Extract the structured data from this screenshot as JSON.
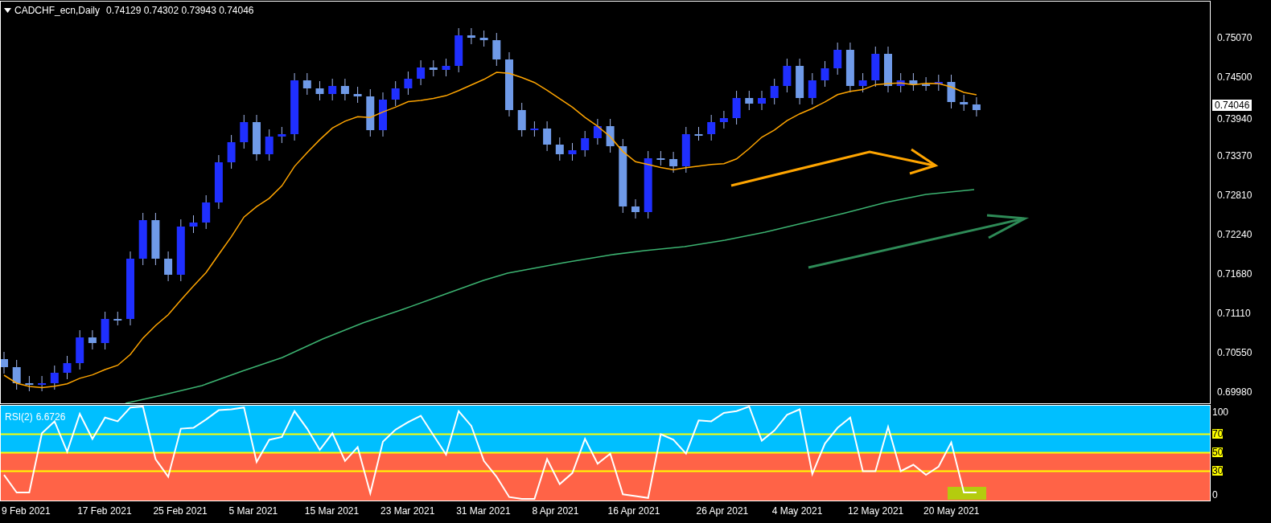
{
  "chart_header": {
    "symbol": "CADCHF_ecn,Daily",
    "ohlc": "0.74129 0.74302 0.73943 0.74046"
  },
  "price_axis": {
    "labels": [
      "0.75070",
      "0.74500",
      "0.73940",
      "0.73370",
      "0.72810",
      "0.72240",
      "0.71680",
      "0.71110",
      "0.70550",
      "0.69980"
    ],
    "current_price": "0.74046"
  },
  "rsi_panel": {
    "current_reading": "6.6726",
    "chart_data": {
      "type": "line",
      "grid": true,
      "ylim": [
        0,
        100
      ],
      "yticks": [
        100,
        {
          "value": 70,
          "label": "70"
        },
        {
          "value": 50,
          "label": "50"
        },
        {
          "value": 30,
          "label": "30"
        },
        0
      ],
      "series": [
        {
          "name": "RSI(2)",
          "color": "#ffffff",
          "values": [
            26,
            7,
            7,
            71,
            84,
            51,
            92,
            65,
            88,
            84,
            99,
            100,
            43,
            24,
            76,
            77,
            86,
            96,
            97,
            99,
            40,
            64,
            67,
            95,
            76,
            53,
            71,
            41,
            56,
            6,
            62,
            75,
            83,
            90,
            69,
            48,
            95,
            79,
            41,
            24,
            2,
            0,
            0,
            43,
            16,
            28,
            65,
            38,
            49,
            5,
            3,
            1,
            70,
            64,
            49,
            85,
            84,
            93,
            95,
            100,
            63,
            74,
            91,
            97,
            27,
            60,
            77,
            88,
            30,
            30,
            78,
            30,
            37,
            26,
            35,
            61,
            7,
            7
          ]
        }
      ]
    }
  },
  "date_axis": {
    "labels": [
      "9 Feb 2021",
      "17 Feb 2021",
      "25 Feb 2021",
      "5 Mar 2021",
      "15 Mar 2021",
      "23 Mar 2021",
      "31 Mar 2021",
      "8 Apr 2021",
      "16 Apr 2021",
      "26 Apr 2021",
      "4 May 2021",
      "12 May 2021",
      "20 May 2021"
    ]
  }
}
